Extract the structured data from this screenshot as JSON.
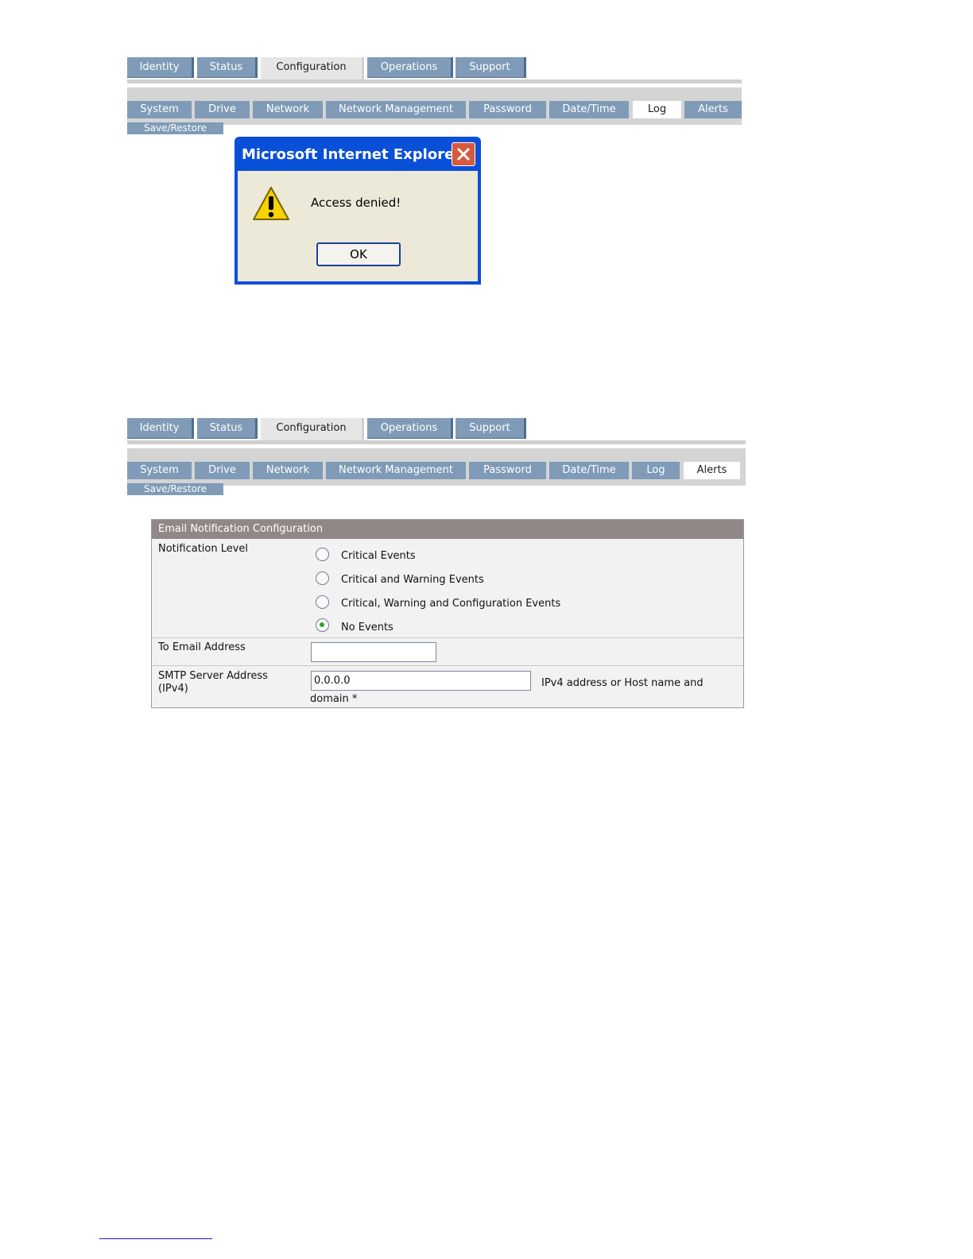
{
  "top_nav": {
    "tabs": [
      "Identity",
      "Status",
      "Configuration",
      "Operations",
      "Support"
    ],
    "active_tab": "Configuration",
    "subtabs": [
      "System",
      "Drive",
      "Network",
      "Network Management",
      "Password",
      "Date/Time",
      "Log",
      "Alerts"
    ],
    "save_restore": "Save/Restore",
    "active_subtab": "Log"
  },
  "dialog": {
    "title": "Microsoft Internet Explorer",
    "message": "Access denied!",
    "ok_label": "OK",
    "icons": {
      "warning": "warning-icon",
      "close": "close-icon"
    }
  },
  "bottom_nav": {
    "tabs": [
      "Identity",
      "Status",
      "Configuration",
      "Operations",
      "Support"
    ],
    "active_tab": "Configuration",
    "subtabs": [
      "System",
      "Drive",
      "Network",
      "Network Management",
      "Password",
      "Date/Time",
      "Log",
      "Alerts"
    ],
    "save_restore": "Save/Restore",
    "active_subtab": "Alerts"
  },
  "email_config": {
    "title": "Email Notification Configuration",
    "notification_level_label": "Notification Level",
    "options": [
      "Critical Events",
      "Critical and Warning Events",
      "Critical, Warning and Configuration Events",
      "No Events"
    ],
    "selected_option": "No Events",
    "to_email_label": "To Email Address",
    "to_email_value": "",
    "smtp_label_line1": "SMTP Server Address",
    "smtp_label_line2": "(IPv4)",
    "smtp_value": "0.0.0.0",
    "smtp_hint_line1": "IPv4 address or Host name and",
    "smtp_hint_line2": "domain *"
  },
  "colors": {
    "tab_blue": "#7f9bb7",
    "tab_shadow": "#4d6e90",
    "panel_header": "#908886",
    "dialog_titlebar": "#0a4fd8",
    "dialog_body": "#ece9d8",
    "radio_selected": "#2ea52e"
  }
}
